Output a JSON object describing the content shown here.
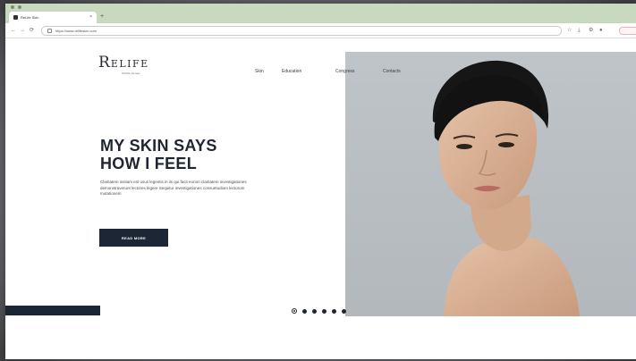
{
  "browser": {
    "tab": {
      "title": "ReLife Skin",
      "close_glyph": "×"
    },
    "new_tab_glyph": "+",
    "nav": {
      "back_glyph": "←",
      "forward_glyph": "→",
      "reload_glyph": "⟳"
    },
    "address": {
      "url": "https://www.relifeskin.com"
    },
    "toolbar_icons": {
      "star_glyph": "☆",
      "download_glyph": "⤓",
      "extension_glyph": "⚙",
      "profile_glyph": "●"
    }
  },
  "site": {
    "logo": {
      "first_letter": "R",
      "rest": "ELIFE",
      "tagline": "Wrinkle therapy"
    },
    "nav_items": [
      "Skin",
      "Education",
      "Congress",
      "Contacts"
    ],
    "hero": {
      "headline_line1": "MY SKIN SAYS",
      "headline_line2": "HOW I FEEL",
      "body": "Claritatem insitam est usus legentis in iis qui facit eorum claritatem investigationes demonstraverunt lectores legere Sequitur investigationes consuetudium lectorum mutationem"
    },
    "cta_label": "READ MORE",
    "slider": {
      "slide_count": 6,
      "active_index": 0
    }
  },
  "colors": {
    "brand_navy": "#1d2635",
    "photo_background": "#b8bdc2",
    "tab_bar": "#c9d9c0"
  }
}
